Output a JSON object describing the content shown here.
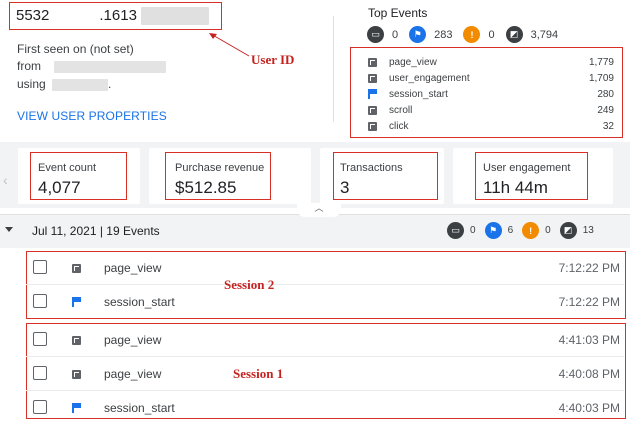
{
  "user": {
    "id_prefix": "5532",
    "id_suffix": ".1613",
    "first_seen": "First seen on (not set)",
    "from_label": "from",
    "using_label": "using",
    "using_trailing": ".",
    "view_properties": "VIEW USER PROPERTIES"
  },
  "annotations": {
    "user_id": "User ID",
    "session2": "Session 2",
    "session1": "Session 1"
  },
  "top_events": {
    "title": "Top Events",
    "summary": [
      {
        "icon": "page-icon",
        "count": "0"
      },
      {
        "icon": "flag-icon",
        "count": "283"
      },
      {
        "icon": "warning-icon",
        "count": "0"
      },
      {
        "icon": "page-icon",
        "count": "3,794"
      }
    ],
    "items": [
      {
        "icon": "page-icon",
        "name": "page_view",
        "count": "1,779"
      },
      {
        "icon": "page-icon",
        "name": "user_engagement",
        "count": "1,709"
      },
      {
        "icon": "flag-icon",
        "name": "session_start",
        "count": "280"
      },
      {
        "icon": "page-icon",
        "name": "scroll",
        "count": "249"
      },
      {
        "icon": "page-icon",
        "name": "click",
        "count": "32"
      }
    ]
  },
  "metrics": [
    {
      "label": "Event count",
      "value": "4,077"
    },
    {
      "label": "Purchase revenue",
      "value": "$512.85"
    },
    {
      "label": "Transactions",
      "value": "3"
    },
    {
      "label": "User engagement",
      "value": "11h 44m"
    }
  ],
  "day": {
    "label": "Jul 11, 2021 | 19 Events",
    "counts": [
      "0",
      "6",
      "0",
      "13"
    ]
  },
  "events": [
    {
      "icon": "page-icon",
      "name": "page_view",
      "time": "7:12:22 PM"
    },
    {
      "icon": "flag-icon",
      "name": "session_start",
      "time": "7:12:22 PM"
    },
    {
      "icon": "page-icon",
      "name": "page_view",
      "time": "4:41:03 PM"
    },
    {
      "icon": "page-icon",
      "name": "page_view",
      "time": "4:40:08 PM"
    },
    {
      "icon": "flag-icon",
      "name": "session_start",
      "time": "4:40:03 PM"
    }
  ],
  "colors": {
    "accent": "#1a73e8",
    "annotation": "#c5221f",
    "warning": "#f28b00"
  }
}
